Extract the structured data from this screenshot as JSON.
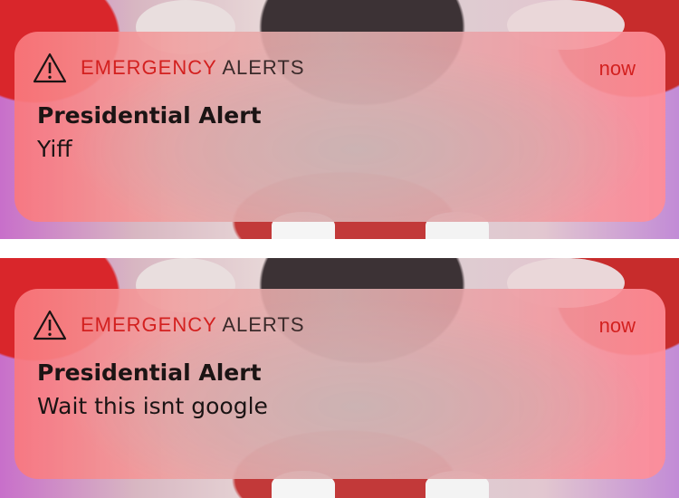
{
  "notifications": [
    {
      "app_name_red": "EMERGENCY",
      "app_name_dark": "ALERTS",
      "time": "now",
      "title": "Presidential Alert",
      "message": "Yiff"
    },
    {
      "app_name_red": "EMERGENCY",
      "app_name_dark": "ALERTS",
      "time": "now",
      "title": "Presidential Alert",
      "message": "Wait this isnt google"
    }
  ],
  "colors": {
    "accent_red": "#d3201f",
    "text_dark": "#1b1414"
  },
  "icons": {
    "header": "warning-triangle-icon"
  }
}
